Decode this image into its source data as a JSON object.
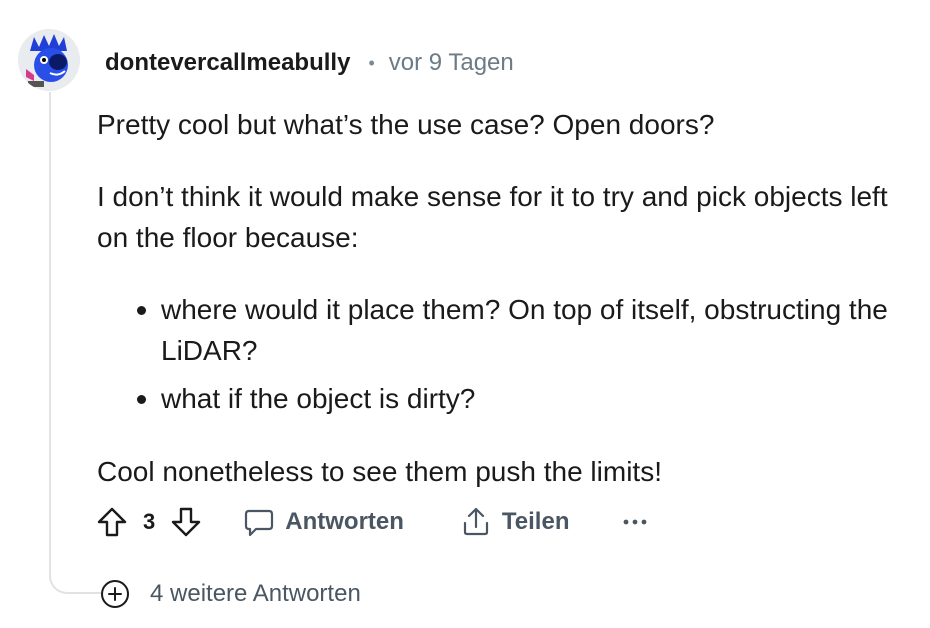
{
  "comment": {
    "author": "dontevercallmeabully",
    "separator": "•",
    "timestamp": "vor 9 Tagen",
    "avatar_icon": "snoo-avatar-icon",
    "paragraph_1": "Pretty cool but what’s the use case? Open doors?",
    "paragraph_2": "I don’t think it would make sense for it to try and pick objects left on the floor because:",
    "bullets": [
      "where would it place them? On top of itself, obstructing the LiDAR?",
      "what if the object is dirty?"
    ],
    "paragraph_3": "Cool nonetheless to see them push the limits!"
  },
  "actions": {
    "score": "3",
    "reply_label": "Antworten",
    "share_label": "Teilen",
    "upvote_icon": "upvote-arrow-icon",
    "downvote_icon": "downvote-arrow-icon",
    "reply_icon": "speech-bubble-icon",
    "share_icon": "share-upload-icon",
    "more_icon": "ellipsis-icon"
  },
  "more_replies": {
    "label": "4 weitere Antworten",
    "icon": "plus-circle-icon"
  },
  "colors": {
    "text": "#1a1a1b",
    "muted": "#6b7b87",
    "action": "#4a5762",
    "thread_line": "#e0e2e4",
    "avatar_blue": "#1f3fd6"
  }
}
